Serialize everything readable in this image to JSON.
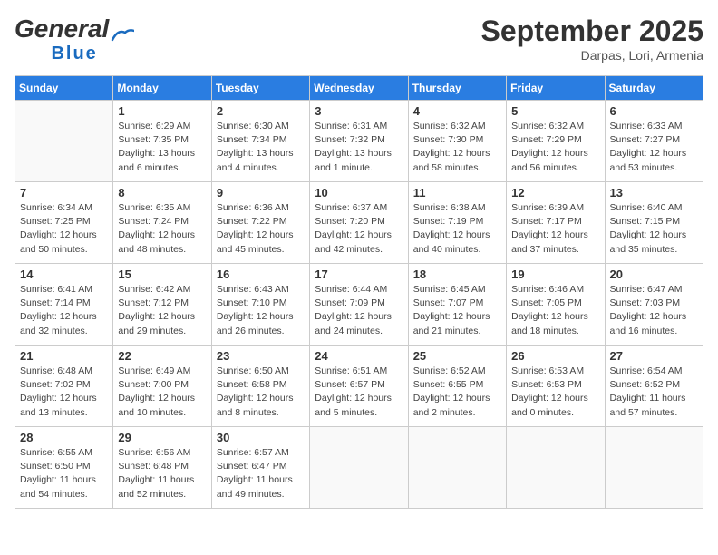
{
  "header": {
    "logo_general": "General",
    "logo_blue": "Blue",
    "month": "September 2025",
    "location": "Darpas, Lori, Armenia"
  },
  "days_of_week": [
    "Sunday",
    "Monday",
    "Tuesday",
    "Wednesday",
    "Thursday",
    "Friday",
    "Saturday"
  ],
  "weeks": [
    [
      {
        "day": "",
        "info": ""
      },
      {
        "day": "1",
        "info": "Sunrise: 6:29 AM\nSunset: 7:35 PM\nDaylight: 13 hours\nand 6 minutes."
      },
      {
        "day": "2",
        "info": "Sunrise: 6:30 AM\nSunset: 7:34 PM\nDaylight: 13 hours\nand 4 minutes."
      },
      {
        "day": "3",
        "info": "Sunrise: 6:31 AM\nSunset: 7:32 PM\nDaylight: 13 hours\nand 1 minute."
      },
      {
        "day": "4",
        "info": "Sunrise: 6:32 AM\nSunset: 7:30 PM\nDaylight: 12 hours\nand 58 minutes."
      },
      {
        "day": "5",
        "info": "Sunrise: 6:32 AM\nSunset: 7:29 PM\nDaylight: 12 hours\nand 56 minutes."
      },
      {
        "day": "6",
        "info": "Sunrise: 6:33 AM\nSunset: 7:27 PM\nDaylight: 12 hours\nand 53 minutes."
      }
    ],
    [
      {
        "day": "7",
        "info": "Sunrise: 6:34 AM\nSunset: 7:25 PM\nDaylight: 12 hours\nand 50 minutes."
      },
      {
        "day": "8",
        "info": "Sunrise: 6:35 AM\nSunset: 7:24 PM\nDaylight: 12 hours\nand 48 minutes."
      },
      {
        "day": "9",
        "info": "Sunrise: 6:36 AM\nSunset: 7:22 PM\nDaylight: 12 hours\nand 45 minutes."
      },
      {
        "day": "10",
        "info": "Sunrise: 6:37 AM\nSunset: 7:20 PM\nDaylight: 12 hours\nand 42 minutes."
      },
      {
        "day": "11",
        "info": "Sunrise: 6:38 AM\nSunset: 7:19 PM\nDaylight: 12 hours\nand 40 minutes."
      },
      {
        "day": "12",
        "info": "Sunrise: 6:39 AM\nSunset: 7:17 PM\nDaylight: 12 hours\nand 37 minutes."
      },
      {
        "day": "13",
        "info": "Sunrise: 6:40 AM\nSunset: 7:15 PM\nDaylight: 12 hours\nand 35 minutes."
      }
    ],
    [
      {
        "day": "14",
        "info": "Sunrise: 6:41 AM\nSunset: 7:14 PM\nDaylight: 12 hours\nand 32 minutes."
      },
      {
        "day": "15",
        "info": "Sunrise: 6:42 AM\nSunset: 7:12 PM\nDaylight: 12 hours\nand 29 minutes."
      },
      {
        "day": "16",
        "info": "Sunrise: 6:43 AM\nSunset: 7:10 PM\nDaylight: 12 hours\nand 26 minutes."
      },
      {
        "day": "17",
        "info": "Sunrise: 6:44 AM\nSunset: 7:09 PM\nDaylight: 12 hours\nand 24 minutes."
      },
      {
        "day": "18",
        "info": "Sunrise: 6:45 AM\nSunset: 7:07 PM\nDaylight: 12 hours\nand 21 minutes."
      },
      {
        "day": "19",
        "info": "Sunrise: 6:46 AM\nSunset: 7:05 PM\nDaylight: 12 hours\nand 18 minutes."
      },
      {
        "day": "20",
        "info": "Sunrise: 6:47 AM\nSunset: 7:03 PM\nDaylight: 12 hours\nand 16 minutes."
      }
    ],
    [
      {
        "day": "21",
        "info": "Sunrise: 6:48 AM\nSunset: 7:02 PM\nDaylight: 12 hours\nand 13 minutes."
      },
      {
        "day": "22",
        "info": "Sunrise: 6:49 AM\nSunset: 7:00 PM\nDaylight: 12 hours\nand 10 minutes."
      },
      {
        "day": "23",
        "info": "Sunrise: 6:50 AM\nSunset: 6:58 PM\nDaylight: 12 hours\nand 8 minutes."
      },
      {
        "day": "24",
        "info": "Sunrise: 6:51 AM\nSunset: 6:57 PM\nDaylight: 12 hours\nand 5 minutes."
      },
      {
        "day": "25",
        "info": "Sunrise: 6:52 AM\nSunset: 6:55 PM\nDaylight: 12 hours\nand 2 minutes."
      },
      {
        "day": "26",
        "info": "Sunrise: 6:53 AM\nSunset: 6:53 PM\nDaylight: 12 hours\nand 0 minutes."
      },
      {
        "day": "27",
        "info": "Sunrise: 6:54 AM\nSunset: 6:52 PM\nDaylight: 11 hours\nand 57 minutes."
      }
    ],
    [
      {
        "day": "28",
        "info": "Sunrise: 6:55 AM\nSunset: 6:50 PM\nDaylight: 11 hours\nand 54 minutes."
      },
      {
        "day": "29",
        "info": "Sunrise: 6:56 AM\nSunset: 6:48 PM\nDaylight: 11 hours\nand 52 minutes."
      },
      {
        "day": "30",
        "info": "Sunrise: 6:57 AM\nSunset: 6:47 PM\nDaylight: 11 hours\nand 49 minutes."
      },
      {
        "day": "",
        "info": ""
      },
      {
        "day": "",
        "info": ""
      },
      {
        "day": "",
        "info": ""
      },
      {
        "day": "",
        "info": ""
      }
    ]
  ]
}
